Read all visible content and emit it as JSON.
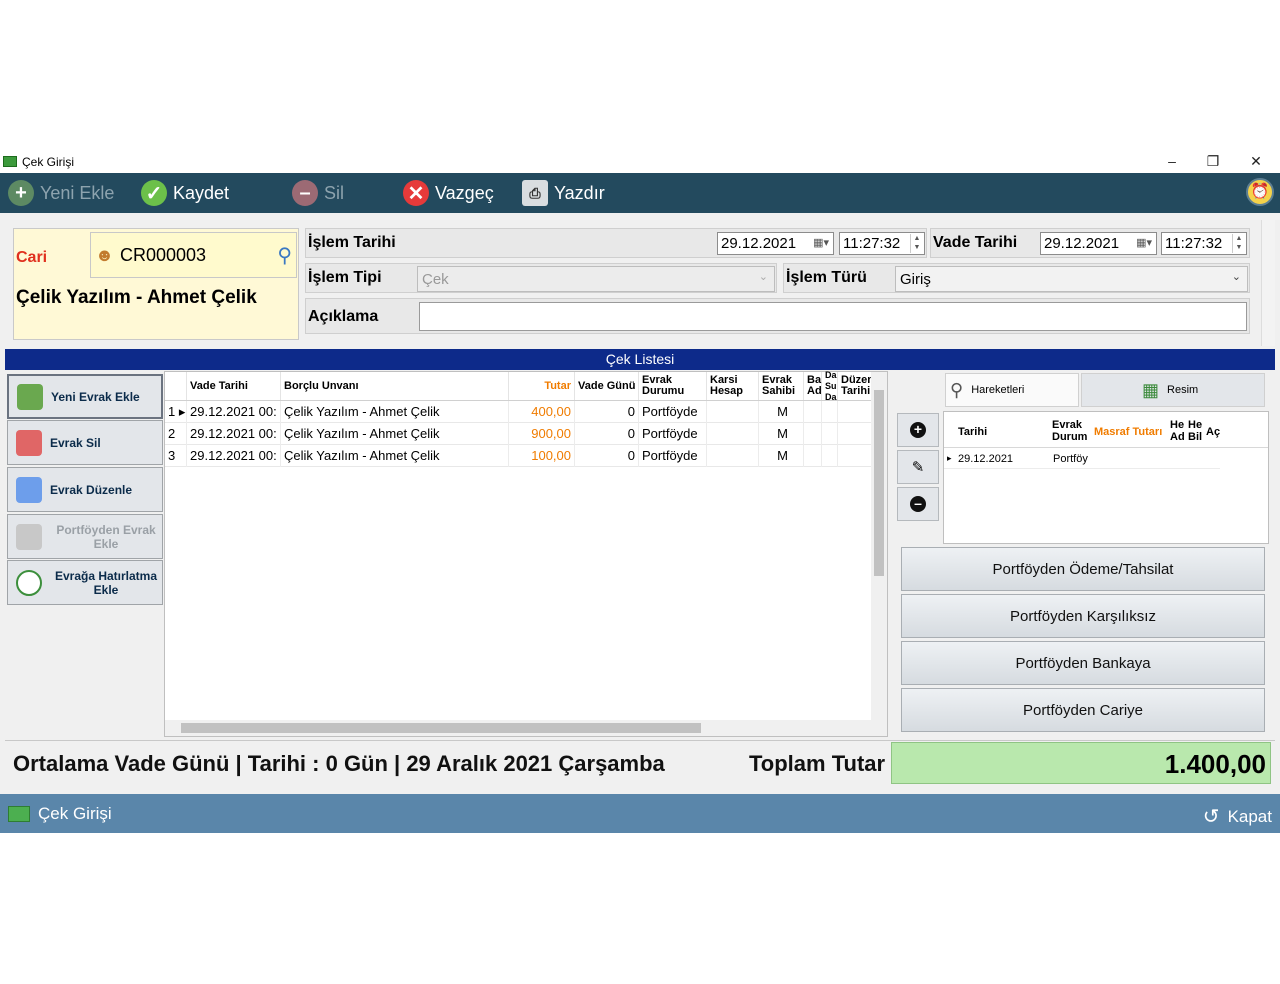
{
  "window": {
    "title": "Çek Girişi"
  },
  "toolbar": {
    "yeni_ekle": "Yeni Ekle",
    "kaydet": "Kaydet",
    "sil": "Sil",
    "vazgec": "Vazgeç",
    "yazdir": "Yazdır"
  },
  "cari": {
    "label": "Cari",
    "code": "CR000003",
    "name": "Çelik Yazılım - Ahmet Çelik"
  },
  "form": {
    "islem_tarihi_label": "İşlem Tarihi",
    "islem_tarihi_date": "29.12.2021",
    "islem_tarihi_time": "11:27:32",
    "vade_tarihi_label": "Vade Tarihi",
    "vade_tarihi_date": "29.12.2021",
    "vade_tarihi_time": "11:27:32",
    "islem_tipi_label": "İşlem Tipi",
    "islem_tipi_value": "Çek",
    "islem_turu_label": "İşlem Türü",
    "islem_turu_value": "Giriş",
    "aciklama_label": "Açıklama",
    "aciklama_value": ""
  },
  "list_title": "Çek Listesi",
  "left_buttons": {
    "yeni_evrak": "Yeni Evrak Ekle",
    "evrak_sil": "Evrak Sil",
    "evrak_duzenle": "Evrak Düzenle",
    "portfoyden_evrak": "Portföyden Evrak Ekle",
    "hatirlatma": "Evrağa Hatırlatma Ekle"
  },
  "grid": {
    "headers": {
      "vade": "Vade Tarihi",
      "borclu": "Borçlu Unvanı",
      "tutar": "Tutar",
      "vade_gunu": "Vade Günü",
      "evrak_durumu": "Evrak Durumu",
      "karsi_hesap": "Karsi Hesap",
      "evrak_sahibi": "Evrak Sahibi",
      "ba": "Ba Ad",
      "da": "Da Su Da",
      "duzen": "Düzen Tarihi"
    },
    "rows": [
      {
        "no": "1",
        "vade": "29.12.2021 00:",
        "borclu": "Çelik Yazılım - Ahmet Çelik",
        "tutar": "400,00",
        "gun": "0",
        "durum": "Portföyde",
        "sahibi": "M"
      },
      {
        "no": "2",
        "vade": "29.12.2021 00:",
        "borclu": "Çelik Yazılım - Ahmet Çelik",
        "tutar": "900,00",
        "gun": "0",
        "durum": "Portföyde",
        "sahibi": "M"
      },
      {
        "no": "3",
        "vade": "29.12.2021 00:",
        "borclu": "Çelik Yazılım - Ahmet Çelik",
        "tutar": "100,00",
        "gun": "0",
        "durum": "Portföyde",
        "sahibi": "M"
      }
    ]
  },
  "right": {
    "tab_hareketleri": "Hareketleri",
    "tab_resim": "Resim",
    "mini_headers": {
      "tarihi": "Tarihi",
      "evrak_durum": "Evrak Durum",
      "masraf": "Masraf Tutarı",
      "he_ad": "He Ad",
      "he_bil": "He Bil",
      "ac": "Aç"
    },
    "mini_row": {
      "tarihi": "29.12.2021",
      "durum": "Portföy"
    },
    "buttons": {
      "odeme": "Portföyden Ödeme/Tahsilat",
      "karsiliksiz": "Portföyden Karşılıksız",
      "bankaya": "Portföyden Bankaya",
      "cariye": "Portföyden Cariye"
    }
  },
  "footer": {
    "summary": "Ortalama Vade Günü | Tarihi : 0 Gün | 29 Aralık 2021 Çarşamba",
    "total_label": "Toplam Tutar",
    "total_value": "1.400,00"
  },
  "statusbar": {
    "title": "Çek Girişi",
    "close": "Kapat"
  },
  "colors": {
    "toolbar_bg": "#234a5e",
    "list_band": "#0d2a8a",
    "status_bg": "#5a86aa",
    "total_bg": "#b9e8ad",
    "cari_bg": "#fff9d6",
    "accent_orange": "#f07c00"
  }
}
